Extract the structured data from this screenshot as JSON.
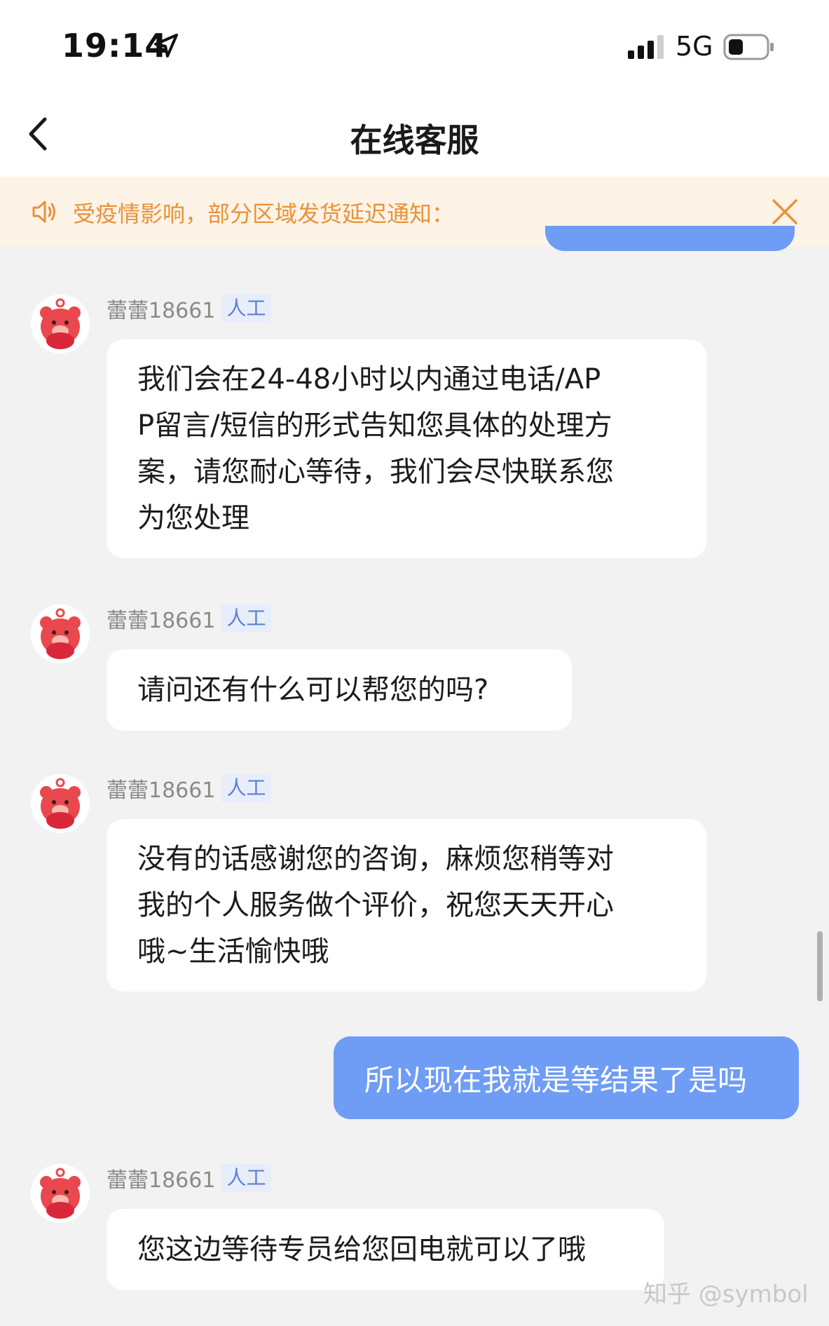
{
  "status_bar": {
    "time": "19:14",
    "network": "5G",
    "location_icon": "location-arrow-icon",
    "signal_icon": "cellular-signal-icon",
    "battery_icon": "battery-icon"
  },
  "nav": {
    "title": "在线客服",
    "back_icon": "chevron-left-icon"
  },
  "notice": {
    "icon": "speaker-icon",
    "text": "受疫情影响，部分区域发货延迟通知：",
    "close_icon": "close-icon",
    "color": "#e9923a",
    "background": "#fdf3e6"
  },
  "colors": {
    "user_bubble": "#6f9cf4",
    "agent_bubble": "#ffffff",
    "chat_background": "#f2f2f2",
    "badge_text": "#5a7fd6"
  },
  "messages": [
    {
      "from": "agent",
      "sender": "蕾蕾18661",
      "badge": "人工",
      "lines": [
        "我们会在24-48小时以内通过电话/AP",
        "P留言/短信的形式告知您具体的处理方",
        "案，请您耐心等待，我们会尽快联系您",
        "为您处理"
      ]
    },
    {
      "from": "agent",
      "sender": "蕾蕾18661",
      "badge": "人工",
      "lines": [
        "请问还有什么可以帮您的吗?"
      ]
    },
    {
      "from": "agent",
      "sender": "蕾蕾18661",
      "badge": "人工",
      "lines": [
        "没有的话感谢您的咨询，麻烦您稍等对",
        "我的个人服务做个评价，祝您天天开心",
        "哦~生活愉快哦"
      ]
    },
    {
      "from": "user",
      "text": "所以现在我就是等结果了是吗"
    },
    {
      "from": "agent",
      "sender": "蕾蕾18661",
      "badge": "人工",
      "lines": [
        "您这边等待专员给您回电就可以了哦"
      ]
    }
  ],
  "watermark": "知乎 @symbol"
}
